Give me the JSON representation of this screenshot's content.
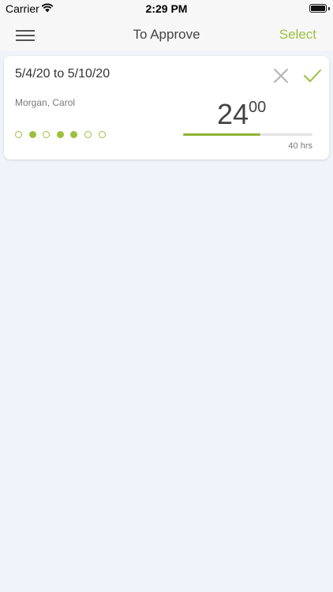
{
  "status_bar": {
    "carrier": "Carrier",
    "time": "2:29 PM"
  },
  "nav": {
    "title": "To Approve",
    "action": "Select"
  },
  "timesheet": {
    "date_range": "5/4/20 to 5/10/20",
    "employee": "Morgan, Carol",
    "hours_whole": "24",
    "hours_fraction": "00",
    "target": "40 hrs",
    "progress": 0.6,
    "days": [
      false,
      true,
      false,
      true,
      true,
      false,
      false
    ]
  },
  "colors": {
    "accent": "#9cc03d",
    "background": "#f0f3fa",
    "card": "#ffffff"
  }
}
